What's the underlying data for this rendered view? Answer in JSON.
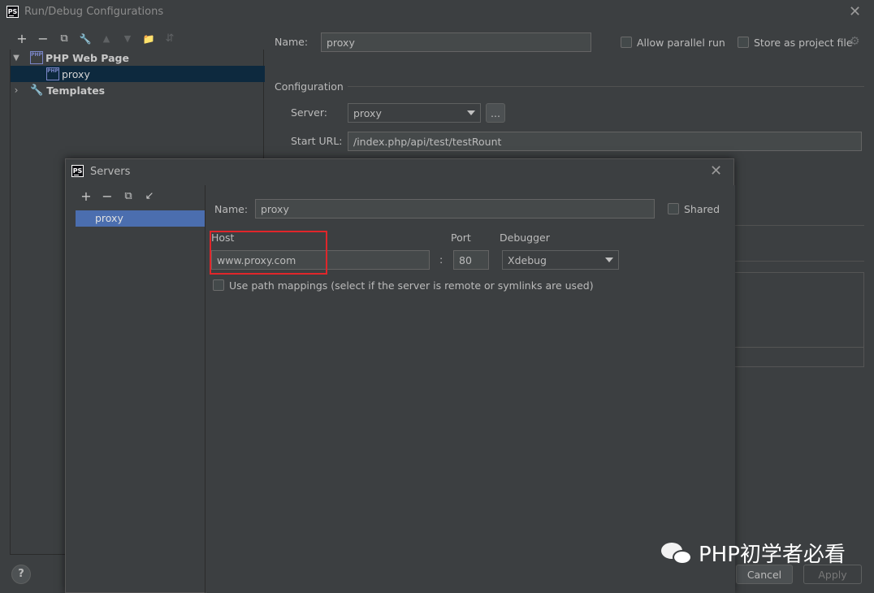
{
  "window": {
    "title": "Run/Debug Configurations",
    "close": "✕"
  },
  "toolbar": {
    "add": "+",
    "remove": "−",
    "copy": "⧉",
    "edit": "🔧",
    "up": "▲",
    "down": "▼",
    "folder": "📁",
    "sort": "⇵"
  },
  "tree": {
    "group_label": "PHP Web Page",
    "child_label": "proxy",
    "templates_label": "Templates"
  },
  "config": {
    "name_label": "Name:",
    "name_value": "proxy",
    "allow_parallel_label": "Allow parallel run",
    "store_project_label": "Store as project file",
    "section_label": "Configuration",
    "server_label": "Server:",
    "server_value": "proxy",
    "browse_label": "...",
    "start_url_label": "Start URL:",
    "start_url_value": "/index.php/api/test/testRount"
  },
  "footer": {
    "help": "?",
    "cancel": "Cancel",
    "apply": "Apply"
  },
  "servers": {
    "title": "Servers",
    "close": "✕",
    "toolbar_add": "+",
    "toolbar_remove": "−",
    "toolbar_copy": "⧉",
    "toolbar_import": "↙",
    "list_item": "proxy",
    "name_label": "Name:",
    "name_value": "proxy",
    "shared_label": "Shared",
    "host_label": "Host",
    "port_label": "Port",
    "debugger_label": "Debugger",
    "host_value": "www.proxy.com",
    "colon": ":",
    "port_value": "80",
    "debugger_value": "Xdebug",
    "path_mappings_label": "Use path mappings (select if the server is remote or symlinks are used)"
  },
  "watermark": {
    "text": "PHP初学者必看"
  },
  "colors": {
    "background": "#3c3f41",
    "selection": "#4b6eaf",
    "tree_selection": "#0d293e",
    "highlight_box": "#e0262a"
  }
}
